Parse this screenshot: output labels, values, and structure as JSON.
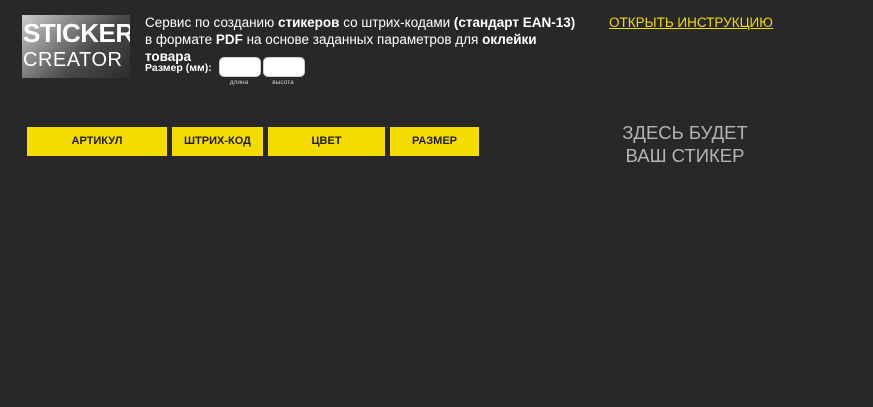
{
  "logo": {
    "line1": "STICKER",
    "line2": "CREATOR"
  },
  "description": {
    "l1_t1": "Сервис по созданию ",
    "l1_b1": "стикеров",
    "l1_t2": " со штрих-кодами ",
    "l1_b2": "(стандарт EAN-13)",
    "l2_t1": "в формате ",
    "l2_b1": "PDF",
    "l2_t2": " на основе заданных параметров для ",
    "l2_b2": "оклейки товара"
  },
  "instruction_link": "ОТКРЫТЬ ИНСТРУКЦИЮ",
  "size": {
    "label": "Размер (мм):",
    "length_value": "",
    "length_hint": "длина",
    "height_value": "",
    "height_hint": "высота"
  },
  "buttons": {
    "article": "АРТИКУЛ",
    "barcode": "ШТРИХ-КОД",
    "color": "ЦВЕТ",
    "size": "РАЗМЕР"
  },
  "preview": {
    "line1": "ЗДЕСЬ БУДЕТ",
    "line2": "ВАШ СТИКЕР"
  },
  "colors": {
    "background": "#282828",
    "accent": "#f5dc00",
    "text": "#ffffff",
    "muted": "#b4b4b4"
  }
}
